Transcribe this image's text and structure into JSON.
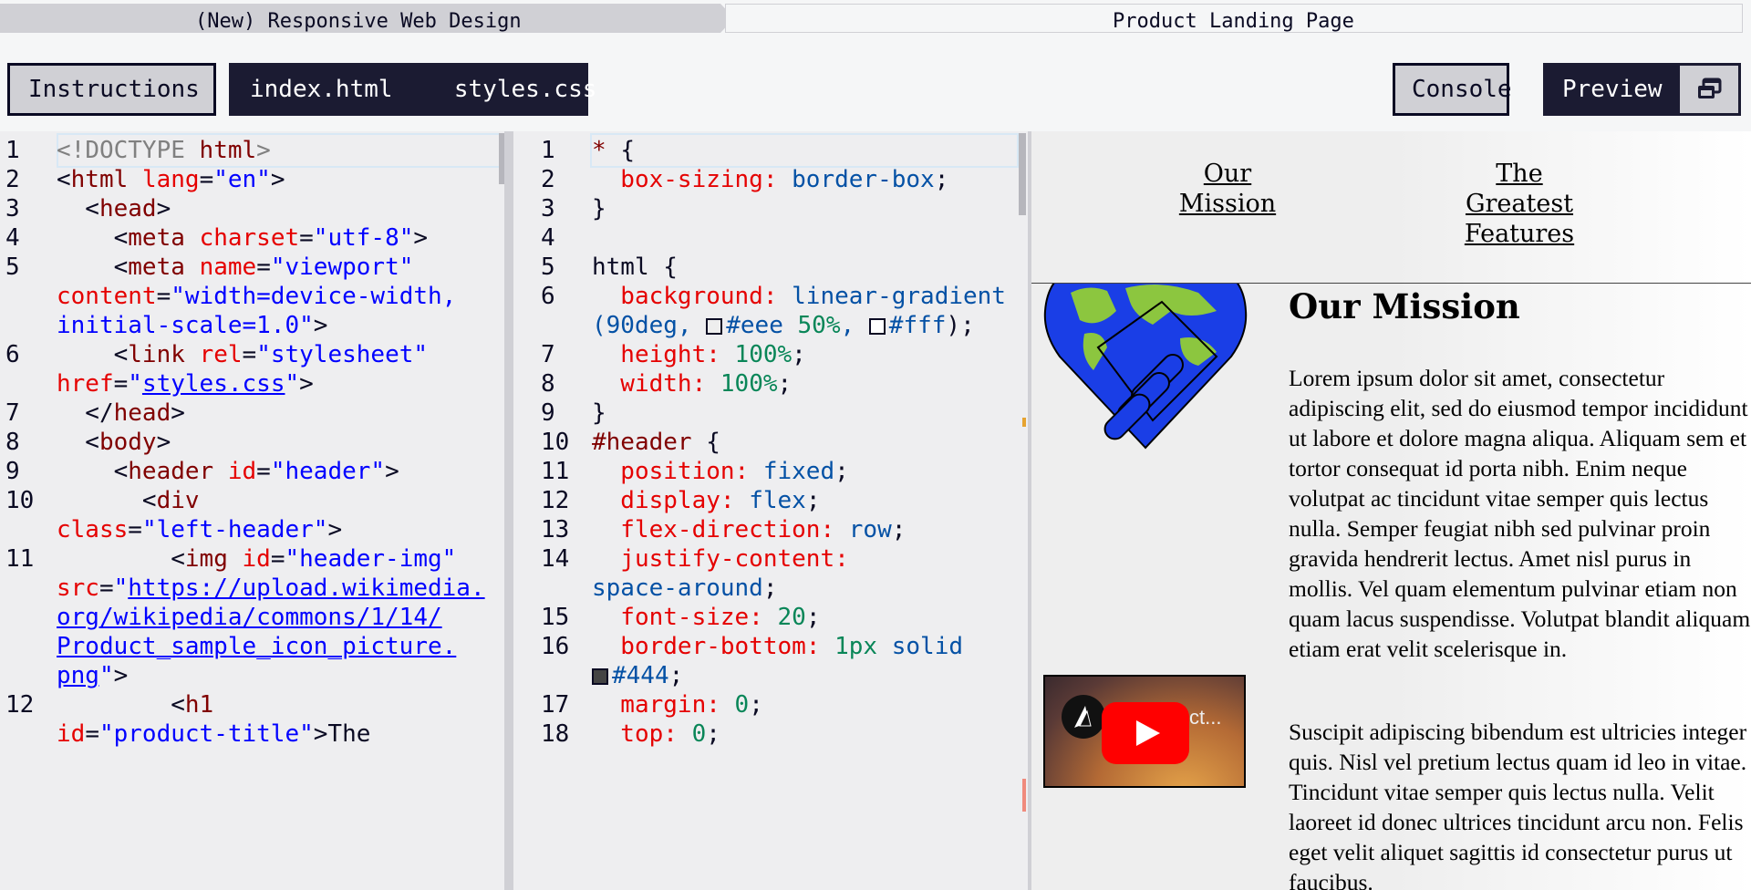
{
  "breadcrumb": {
    "course": "(New) Responsive Web Design",
    "project": "Product Landing Page"
  },
  "toolbar": {
    "instructions": "Instructions",
    "file_html": "index.html",
    "file_css": "styles.css",
    "console": "Console",
    "preview": "Preview",
    "preview_icon": "popout-window-icon"
  },
  "html_editor": {
    "line_numbers": [
      "1",
      "2",
      "3",
      "4",
      "5",
      "6",
      "7",
      "8",
      "9",
      "10",
      "11",
      "12"
    ],
    "lines": [
      {
        "num": "1",
        "t": [
          [
            "gray",
            "<!"
          ],
          [
            "gray",
            "DOCTYPE "
          ],
          [
            "tag",
            "html"
          ],
          [
            "gray",
            ">"
          ]
        ]
      },
      {
        "num": "2",
        "t": [
          [
            "punct",
            "<"
          ],
          [
            "tag",
            "html "
          ],
          [
            "attr",
            "lang"
          ],
          [
            "punct",
            "="
          ],
          [
            "val",
            "\"en\""
          ],
          [
            "punct",
            ">"
          ]
        ]
      },
      {
        "num": "3",
        "t": [
          [
            "punct",
            "  <"
          ],
          [
            "tag",
            "head"
          ],
          [
            "punct",
            ">"
          ]
        ]
      },
      {
        "num": "4",
        "t": [
          [
            "punct",
            "    <"
          ],
          [
            "tag",
            "meta "
          ],
          [
            "attr",
            "charset"
          ],
          [
            "punct",
            "="
          ],
          [
            "val",
            "\"utf-8\""
          ],
          [
            "punct",
            ">"
          ]
        ]
      },
      {
        "num": "5",
        "t": [
          [
            "punct",
            "    <"
          ],
          [
            "tag",
            "meta "
          ],
          [
            "attr",
            "name"
          ],
          [
            "punct",
            "="
          ],
          [
            "val",
            "\"viewport\""
          ]
        ]
      },
      {
        "num": "",
        "t": [
          [
            "attr",
            "content"
          ],
          [
            "punct",
            "="
          ],
          [
            "val",
            "\"width=device-width,"
          ]
        ]
      },
      {
        "num": "",
        "t": [
          [
            "val",
            "initial-scale=1.0\""
          ],
          [
            "punct",
            ">"
          ]
        ]
      },
      {
        "num": "6",
        "t": [
          [
            "punct",
            "    <"
          ],
          [
            "tag",
            "link "
          ],
          [
            "attr",
            "rel"
          ],
          [
            "punct",
            "="
          ],
          [
            "val",
            "\"stylesheet\""
          ]
        ]
      },
      {
        "num": "",
        "t": [
          [
            "attr",
            "href"
          ],
          [
            "punct",
            "="
          ],
          [
            "val",
            "\""
          ],
          [
            "link",
            "styles.css"
          ],
          [
            "val",
            "\""
          ],
          [
            "punct",
            ">"
          ]
        ]
      },
      {
        "num": "7",
        "t": [
          [
            "punct",
            "  </"
          ],
          [
            "tag",
            "head"
          ],
          [
            "punct",
            ">"
          ]
        ]
      },
      {
        "num": "8",
        "t": [
          [
            "punct",
            "  <"
          ],
          [
            "tag",
            "body"
          ],
          [
            "punct",
            ">"
          ]
        ]
      },
      {
        "num": "9",
        "t": [
          [
            "punct",
            "    <"
          ],
          [
            "tag",
            "header "
          ],
          [
            "attr",
            "id"
          ],
          [
            "punct",
            "="
          ],
          [
            "val",
            "\"header\""
          ],
          [
            "punct",
            ">"
          ]
        ]
      },
      {
        "num": "10",
        "t": [
          [
            "punct",
            "      <"
          ],
          [
            "tag",
            "div"
          ]
        ]
      },
      {
        "num": "",
        "t": [
          [
            "attr",
            "class"
          ],
          [
            "punct",
            "="
          ],
          [
            "val",
            "\"left-header\""
          ],
          [
            "punct",
            ">"
          ]
        ]
      },
      {
        "num": "11",
        "t": [
          [
            "punct",
            "        <"
          ],
          [
            "tag",
            "img "
          ],
          [
            "attr",
            "id"
          ],
          [
            "punct",
            "="
          ],
          [
            "val",
            "\"header-img\""
          ]
        ]
      },
      {
        "num": "",
        "t": [
          [
            "attr",
            "src"
          ],
          [
            "punct",
            "="
          ],
          [
            "val",
            "\""
          ],
          [
            "link",
            "https://upload.wikimedia."
          ]
        ]
      },
      {
        "num": "",
        "t": [
          [
            "link",
            "org/wikipedia/commons/1/14/"
          ]
        ]
      },
      {
        "num": "",
        "t": [
          [
            "link",
            "Product_sample_icon_picture."
          ]
        ]
      },
      {
        "num": "",
        "t": [
          [
            "link",
            "png"
          ],
          [
            "val",
            "\""
          ],
          [
            "punct",
            ">"
          ]
        ]
      },
      {
        "num": "12",
        "t": [
          [
            "punct",
            "        <"
          ],
          [
            "tag",
            "h1"
          ]
        ]
      },
      {
        "num": "",
        "t": [
          [
            "attr",
            "id"
          ],
          [
            "punct",
            "="
          ],
          [
            "val",
            "\"product-title\""
          ],
          [
            "punct",
            ">The"
          ]
        ]
      }
    ]
  },
  "css_editor": {
    "lines": [
      {
        "num": "1",
        "t": [
          [
            "sel",
            "* "
          ],
          [
            "punct",
            "{"
          ]
        ]
      },
      {
        "num": "2",
        "t": [
          [
            "prop",
            "  box-sizing: "
          ],
          [
            "val",
            "border-box"
          ],
          [
            "punct",
            ";"
          ]
        ]
      },
      {
        "num": "3",
        "t": [
          [
            "punct",
            "}"
          ]
        ]
      },
      {
        "num": "4",
        "t": []
      },
      {
        "num": "5",
        "t": [
          [
            "punct",
            "html {"
          ]
        ]
      },
      {
        "num": "6",
        "t": [
          [
            "prop",
            "  background: "
          ],
          [
            "val",
            "linear-gradient"
          ]
        ]
      },
      {
        "num": "",
        "t": [
          [
            "val",
            "(90deg, "
          ],
          [
            "sw",
            "#eee"
          ],
          [
            "val",
            "#eee "
          ],
          [
            "num",
            "50%"
          ],
          [
            "val",
            ", "
          ],
          [
            "sw",
            "#fff"
          ],
          [
            "val",
            "#fff"
          ],
          [
            "punct",
            ");"
          ]
        ]
      },
      {
        "num": "7",
        "t": [
          [
            "prop",
            "  height: "
          ],
          [
            "num",
            "100%"
          ],
          [
            "punct",
            ";"
          ]
        ]
      },
      {
        "num": "8",
        "t": [
          [
            "prop",
            "  width: "
          ],
          [
            "num",
            "100%"
          ],
          [
            "punct",
            ";"
          ]
        ]
      },
      {
        "num": "9",
        "t": [
          [
            "punct",
            "}"
          ]
        ]
      },
      {
        "num": "10",
        "t": [
          [
            "sel",
            "#header "
          ],
          [
            "punct",
            "{"
          ]
        ]
      },
      {
        "num": "11",
        "t": [
          [
            "prop",
            "  position: "
          ],
          [
            "val",
            "fixed"
          ],
          [
            "punct",
            ";"
          ]
        ]
      },
      {
        "num": "12",
        "t": [
          [
            "prop",
            "  display: "
          ],
          [
            "val",
            "flex"
          ],
          [
            "punct",
            ";"
          ]
        ]
      },
      {
        "num": "13",
        "t": [
          [
            "prop",
            "  flex-direction: "
          ],
          [
            "val",
            "row"
          ],
          [
            "punct",
            ";"
          ]
        ]
      },
      {
        "num": "14",
        "t": [
          [
            "prop",
            "  justify-content: "
          ]
        ]
      },
      {
        "num": "",
        "t": [
          [
            "val",
            "space-around"
          ],
          [
            "punct",
            ";"
          ]
        ]
      },
      {
        "num": "15",
        "t": [
          [
            "prop",
            "  font-size: "
          ],
          [
            "num",
            "20"
          ],
          [
            "punct",
            ";"
          ]
        ]
      },
      {
        "num": "16",
        "t": [
          [
            "prop",
            "  border-bottom: "
          ],
          [
            "num",
            "1px "
          ],
          [
            "val",
            "solid"
          ]
        ]
      },
      {
        "num": "",
        "t": [
          [
            "sw",
            "#444"
          ],
          [
            "val",
            "#444"
          ],
          [
            "punct",
            ";"
          ]
        ]
      },
      {
        "num": "17",
        "t": [
          [
            "prop",
            "  margin: "
          ],
          [
            "num",
            "0"
          ],
          [
            "punct",
            ";"
          ]
        ]
      },
      {
        "num": "18",
        "t": [
          [
            "prop",
            "  top: "
          ],
          [
            "num",
            "0"
          ],
          [
            "punct",
            ";"
          ]
        ]
      }
    ]
  },
  "preview": {
    "nav_links": [
      "Our Mission",
      "The Greatest Features"
    ],
    "nav_link_lines": [
      [
        "Our",
        "Mission"
      ],
      [
        "The",
        "Greatest",
        "Features"
      ]
    ],
    "section_title": "Our Mission",
    "paragraph_1": "Lorem ipsum dolor sit amet, consectetur adipiscing elit, sed do eiusmod tempor incididunt ut labore et dolore magna aliqua. Aliquam sem et tortor consequat id porta nibh. Enim neque volutpat ac tincidunt vitae semper quis lectus nulla. Semper feugiat nibh sed pulvinar proin gravida hendrerit lectus. Amet nisl purus in mollis. Vel quam elementum pulvinar etiam non quam lacus suspendisse. Volutpat blandit aliquam etiam erat velit scelerisque in.",
    "paragraph_2": "Suscipit adipiscing bibendum est ultricies integer quis. Nisl vel pretium lectus quam id leo in vitae. Tincidunt vitae semper quis lectus nulla. Velit laoreet id donec ultrices tincidunt arcu non. Felis eget velit aliquet sagittis id consectetur purus ut faucibus.",
    "video_title_fragment": "ct...",
    "image_icon": "globe-handshake-icon",
    "video_play_icon": "youtube-play-icon"
  },
  "colors": {
    "dark": "#1b1b32",
    "light": "#d0d0d5",
    "tag": "#800000",
    "attr": "#e50000",
    "value": "#0000ff",
    "css_value": "#0451a5",
    "number": "#098658"
  }
}
